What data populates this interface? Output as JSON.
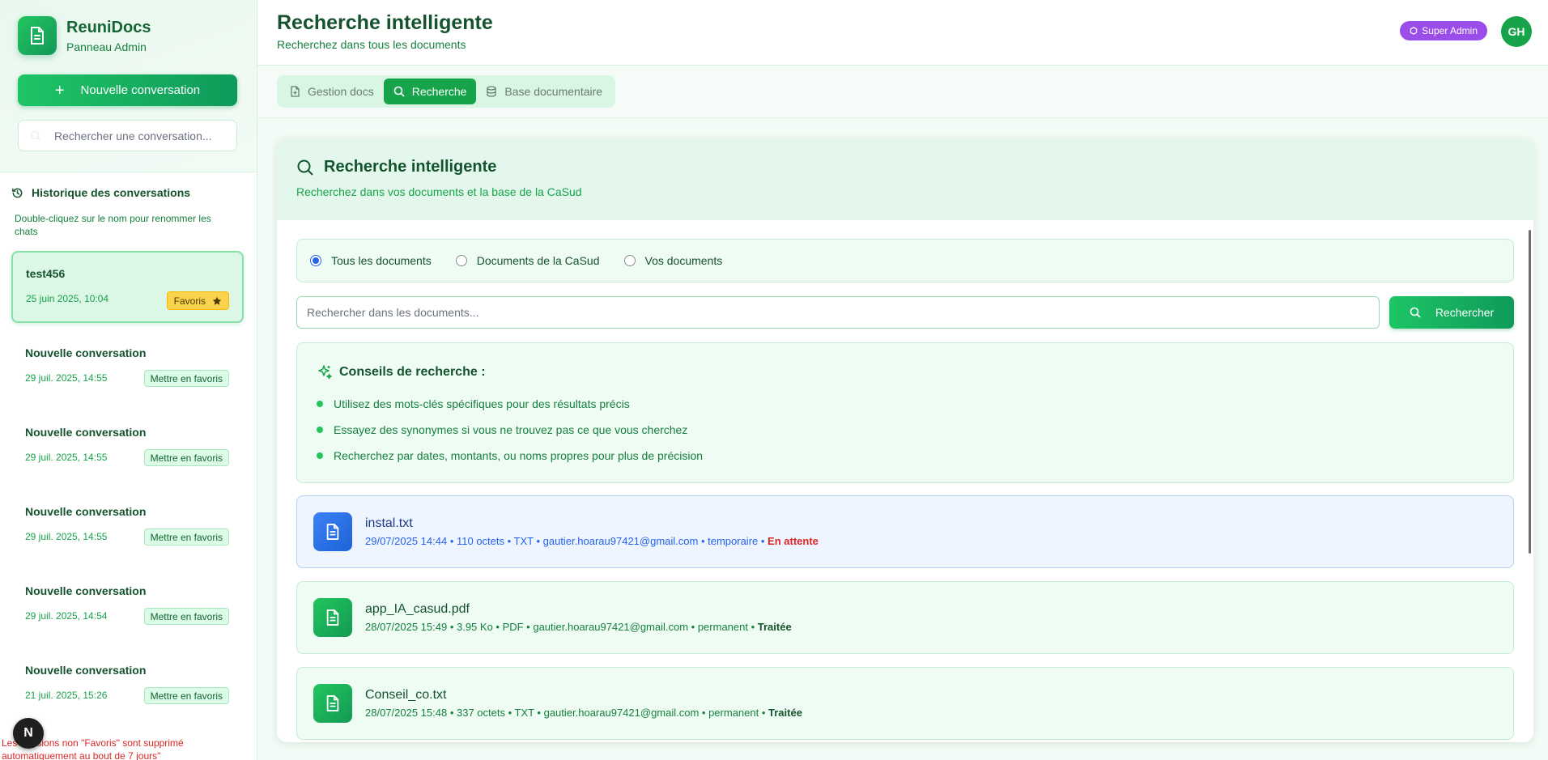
{
  "brand": {
    "name": "ReuniDocs",
    "subtitle": "Panneau Admin"
  },
  "sidebar": {
    "new_conversation": "Nouvelle conversation",
    "search_placeholder": "Rechercher une conversation...",
    "history_title": "Historique des conversations",
    "history_hint": "Double-cliquez sur le nom pour renommer les chats",
    "conversations": [
      {
        "title": "test456",
        "date": "25 juin 2025, 10:04",
        "badge": "Favoris",
        "favorite": true
      },
      {
        "title": "Nouvelle conversation",
        "date": "29 juil. 2025, 14:55",
        "badge": "Mettre en favoris",
        "favorite": false
      },
      {
        "title": "Nouvelle conversation",
        "date": "29 juil. 2025, 14:55",
        "badge": "Mettre en favoris",
        "favorite": false
      },
      {
        "title": "Nouvelle conversation",
        "date": "29 juil. 2025, 14:55",
        "badge": "Mettre en favoris",
        "favorite": false
      },
      {
        "title": "Nouvelle conversation",
        "date": "29 juil. 2025, 14:54",
        "badge": "Mettre en favoris",
        "favorite": false
      },
      {
        "title": "Nouvelle conversation",
        "date": "21 juil. 2025, 15:26",
        "badge": "Mettre en favoris",
        "favorite": false
      }
    ],
    "warning": "Les Sessions non \"Favoris\" sont supprimé automatiquement au bout de 7 jours\"",
    "next_badge": "N"
  },
  "header": {
    "title": "Recherche intelligente",
    "subtitle": "Recherchez dans tous les documents",
    "role": "Super Admin",
    "avatar": "GH"
  },
  "tabs": [
    {
      "label": "Gestion docs",
      "icon": "file-plus-icon",
      "active": false
    },
    {
      "label": "Recherche",
      "icon": "search-icon",
      "active": true
    },
    {
      "label": "Base documentaire",
      "icon": "database-icon",
      "active": false
    }
  ],
  "search_panel": {
    "title": "Recherche intelligente",
    "subtitle": "Recherchez dans vos documents et la base de la CaSud",
    "scope_options": [
      {
        "label": "Tous les documents",
        "selected": true
      },
      {
        "label": "Documents de la CaSud",
        "selected": false
      },
      {
        "label": "Vos documents",
        "selected": false
      }
    ],
    "input_placeholder": "Rechercher dans les documents...",
    "button_label": "Rechercher",
    "tips_title": "Conseils de recherche :",
    "tips": [
      "Utilisez des mots-clés spécifiques pour des résultats précis",
      "Essayez des synonymes si vous ne trouvez pas ce que vous cherchez",
      "Recherchez par dates, montants, ou noms propres pour plus de précision"
    ]
  },
  "documents": [
    {
      "name": "instal.txt",
      "meta": "29/07/2025 14:44 • 110 octets • TXT • gautier.hoarau97421@gmail.com • temporaire • ",
      "status": "En attente",
      "pending": true
    },
    {
      "name": "app_IA_casud.pdf",
      "meta": "28/07/2025 15:49 • 3.95 Ko • PDF • gautier.hoarau97421@gmail.com • permanent • ",
      "status": "Traitée",
      "pending": false
    },
    {
      "name": "Conseil_co.txt",
      "meta": "28/07/2025 15:48 • 337 octets • TXT • gautier.hoarau97421@gmail.com • permanent • ",
      "status": "Traitée",
      "pending": false
    }
  ],
  "colors": {
    "brand_green": "#16a34a",
    "role_purple": "#9b4dea",
    "pending_red": "#dc2626",
    "pending_blue": "#2563eb"
  }
}
